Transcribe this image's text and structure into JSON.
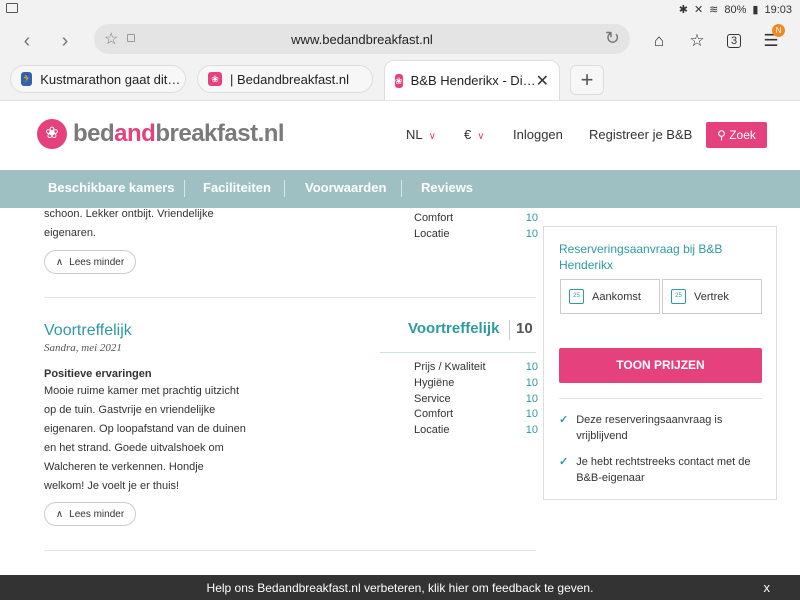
{
  "statusbar": {
    "battery": "80%",
    "time": "19:03"
  },
  "browser": {
    "url": "www.bedandbreakfast.nl",
    "tabs_count": "3",
    "menu_badge": "N",
    "tabs": [
      {
        "label": "Kustmarathon gaat dit…"
      },
      {
        "label": "| Bedandbreakfast.nl"
      },
      {
        "label": "B&B Henderikx - Di…"
      }
    ]
  },
  "site": {
    "logo_part1": "bed",
    "logo_part2": "and",
    "logo_part3": "breakfast",
    "logo_part4": ".nl",
    "lang": "NL",
    "currency": "€",
    "login": "Inloggen",
    "register": "Registreer je B&B",
    "search": "Zoek"
  },
  "subnav": [
    "Beschikbare kamers",
    "Faciliteiten",
    "Voorwaarden",
    "Reviews"
  ],
  "review1": {
    "text_line1": "schoon. Lekker ontbijt. Vriendelijke",
    "text_line2": "eigenaren.",
    "read_less": "Lees minder",
    "scores": [
      {
        "label": "Comfort",
        "value": "10"
      },
      {
        "label": "Locatie",
        "value": "10"
      }
    ]
  },
  "review2": {
    "title": "Voortreffelijk",
    "author": "Sandra, mei 2021",
    "overall_label": "Voortreffelijk",
    "overall_score": "10",
    "section": "Positieve ervaringen",
    "lines": [
      "Mooie ruime kamer met prachtig uitzicht",
      "op de tuin. Gastvrije en vriendelijke",
      "eigenaren. Op loopafstand van de duinen",
      "en het strand. Goede uitvalshoek om",
      "Walcheren te verkennen. Hondje",
      "welkom! Je voelt je er thuis!"
    ],
    "read_less": "Lees minder",
    "scores": [
      {
        "label": "Prijs / Kwaliteit",
        "value": "10"
      },
      {
        "label": "Hygiëne",
        "value": "10"
      },
      {
        "label": "Service",
        "value": "10"
      },
      {
        "label": "Comfort",
        "value": "10"
      },
      {
        "label": "Locatie",
        "value": "10"
      }
    ]
  },
  "booking": {
    "title": "Reserveringsaanvraag bij B&B Henderikx",
    "calendar_day": "25",
    "arrival": "Aankomst",
    "departure": "Vertrek",
    "button": "TOON PRIJZEN",
    "bullet1": "Deze reserveringsaanvraag is vrijblijvend",
    "bullet2": "Je hebt rechtstreeks contact met de B&B-eigenaar"
  },
  "feedback": {
    "message": "Help ons Bedandbreakfast.nl verbeteren, klik hier om feedback te geven.",
    "close": "x"
  }
}
